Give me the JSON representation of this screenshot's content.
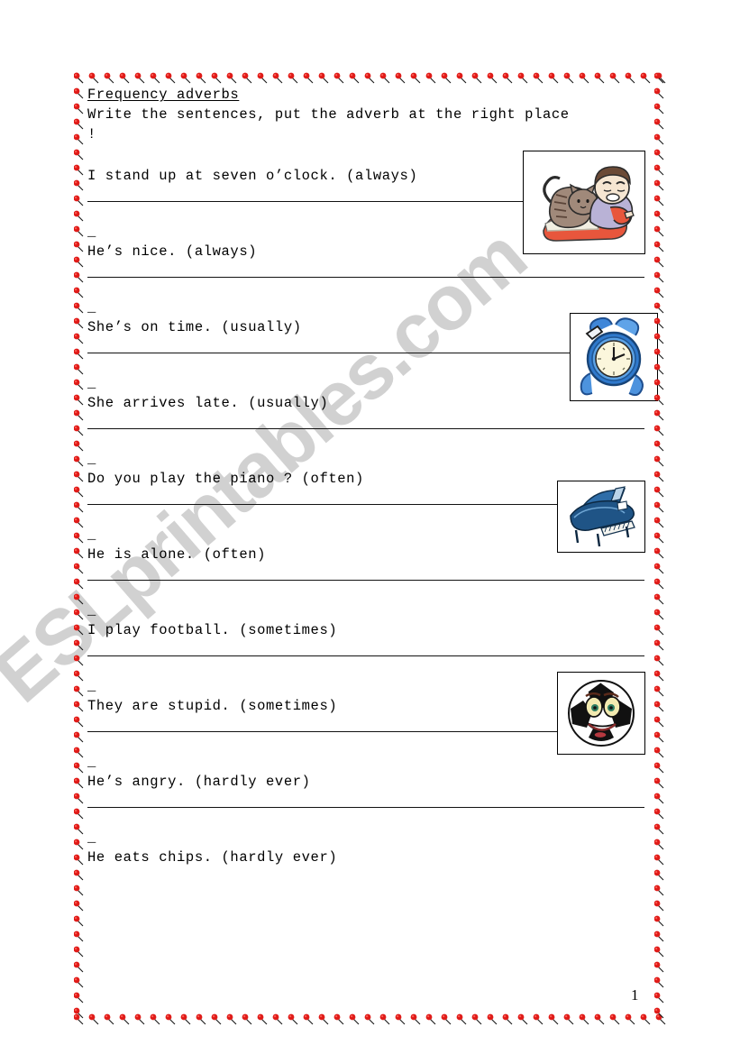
{
  "worksheet": {
    "title": "Frequency adverbs",
    "instructions": "Write the sentences, put the adverb at the right place !",
    "dash_marker": "_",
    "page_number": "1",
    "watermark": "ESLprintables.com",
    "border_style": "red-cherry-dots",
    "accent_color": "#e01b18",
    "ink_color": "#000000",
    "exercises": [
      {
        "id": 1,
        "sentence": "I stand up at seven o’clock. (always)",
        "adverb": "always"
      },
      {
        "id": 2,
        "sentence": "He’s nice. (always)",
        "adverb": "always"
      },
      {
        "id": 3,
        "sentence": "She’s on time. (usually)",
        "adverb": "usually"
      },
      {
        "id": 4,
        "sentence": "She arrives late. (usually)",
        "adverb": "usually"
      },
      {
        "id": 5,
        "sentence": "Do you play the piano ? (often)",
        "adverb": "often"
      },
      {
        "id": 6,
        "sentence": "He is alone. (often)",
        "adverb": "often"
      },
      {
        "id": 7,
        "sentence": "I play football. (sometimes)",
        "adverb": "sometimes"
      },
      {
        "id": 8,
        "sentence": "They are stupid. (sometimes)",
        "adverb": "sometimes"
      },
      {
        "id": 9,
        "sentence": "He’s angry. (hardly ever)",
        "adverb": "hardly ever"
      },
      {
        "id": 10,
        "sentence": "He eats chips. (hardly ever)",
        "adverb": "hardly ever"
      }
    ],
    "pictures": [
      {
        "name": "waking-up-person-with-cat-image",
        "alt": "Person stretching in bed with a cat"
      },
      {
        "name": "alarm-clock-image",
        "alt": "Blue alarm clock"
      },
      {
        "name": "grand-piano-image",
        "alt": "Blue grand piano"
      },
      {
        "name": "smiling-football-image",
        "alt": "Cartoon soccer ball with a face"
      }
    ]
  }
}
